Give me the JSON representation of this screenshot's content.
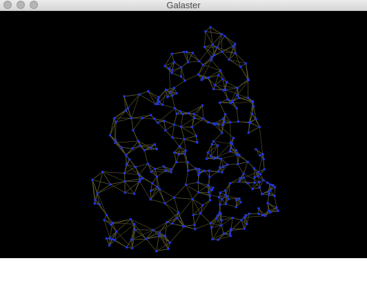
{
  "window": {
    "title": "Galaster"
  },
  "icons": [
    "close-icon",
    "minimize-icon",
    "zoom-icon"
  ],
  "colors": {
    "titlebar": "#dedede",
    "canvas_background": "#000000",
    "node": "#1f34e6",
    "edge": "#5c5a2e"
  }
}
